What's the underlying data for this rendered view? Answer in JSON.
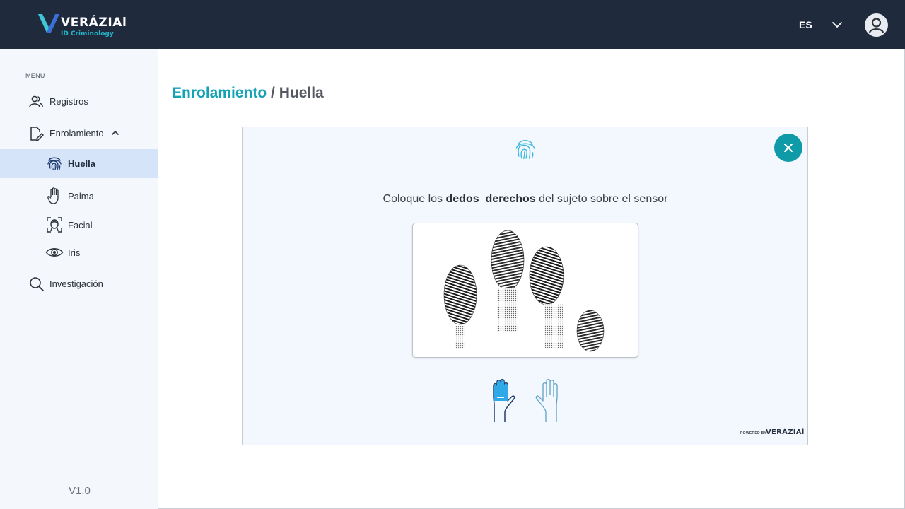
{
  "header": {
    "logo_text": "VERÁZIAl",
    "logo_subtitle": "ID Criminology",
    "language": "ES"
  },
  "sidebar": {
    "menu_label": "MENU",
    "items": [
      {
        "label": "Registros",
        "icon": "users-icon"
      },
      {
        "label": "Enrolamiento",
        "icon": "enroll-icon"
      },
      {
        "label": "Huella",
        "icon": "fingerprint-icon"
      },
      {
        "label": "Palma",
        "icon": "palm-icon"
      },
      {
        "label": "Facial",
        "icon": "face-scan-icon"
      },
      {
        "label": "Iris",
        "icon": "eye-icon"
      },
      {
        "label": "Investigación",
        "icon": "search-icon"
      }
    ],
    "version": "V1.0"
  },
  "breadcrumb": {
    "main": "Enrolamiento",
    "separator": "/",
    "current": "Huella"
  },
  "capture": {
    "instruction_prefix": "Coloque los",
    "instruction_bold": "dedos  derechos",
    "instruction_suffix": "del sujeto sobre el sensor",
    "powered_by": "POWERED BY",
    "powered_logo": "VERÁZIAl"
  },
  "colors": {
    "header_bg": "#1f2a3c",
    "accent": "#13a3b4",
    "close_button": "#0e9aa7",
    "active_item_bg": "#d6e4fa"
  }
}
